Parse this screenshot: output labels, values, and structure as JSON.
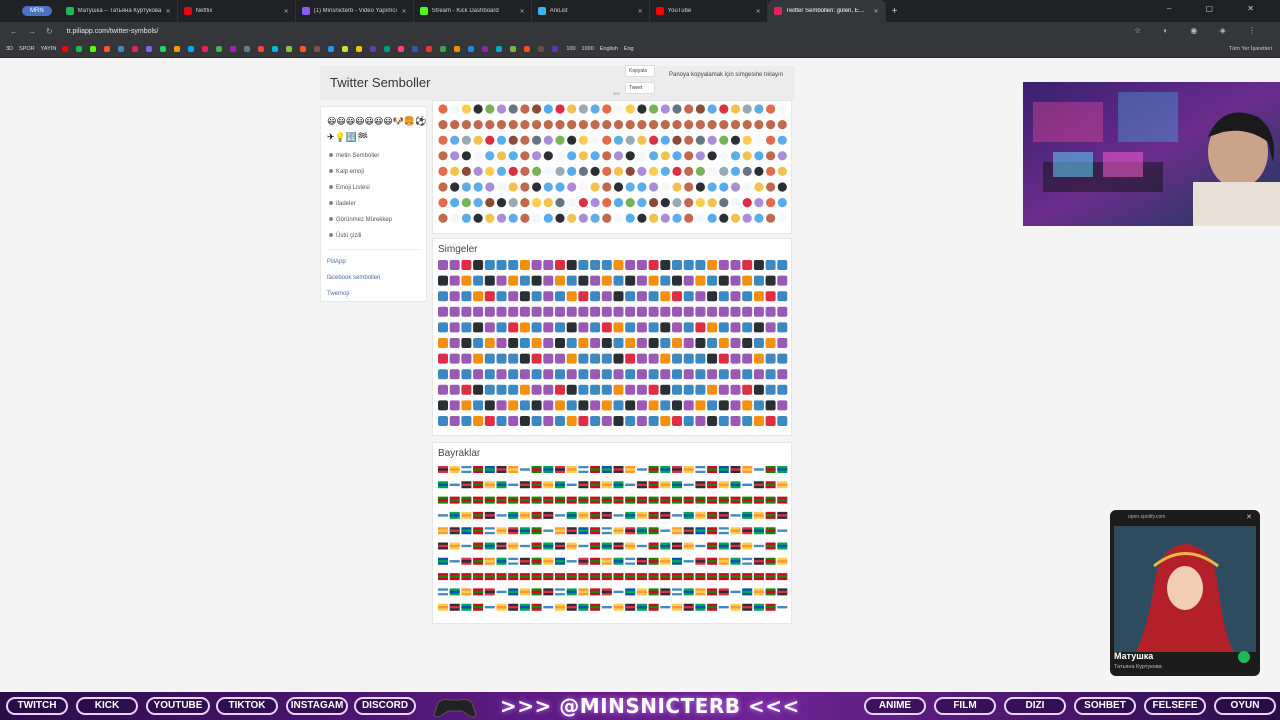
{
  "browser": {
    "tab_pill": "MRN",
    "tabs": [
      {
        "title": "Матушка – Татьяна Куртукова",
        "color": "#1db954",
        "active": false
      },
      {
        "title": "Netflix",
        "color": "#e50914",
        "active": false
      },
      {
        "title": "(1) Minsnicterb - Video Yapımcı",
        "color": "#8a5cf6",
        "active": false
      },
      {
        "title": "Stream - Kick Dashboard",
        "color": "#53fc18",
        "active": false
      },
      {
        "title": "AniList",
        "color": "#3db4f2",
        "active": false
      },
      {
        "title": "YouTube",
        "color": "#ff0000",
        "active": false
      },
      {
        "title": "Twitter Sembolleri: gülen, Emoji",
        "color": "#e0245e",
        "active": true
      }
    ],
    "url": "tr.piliapp.com/twitter-symbols/",
    "bookmarks_left": [
      "3D",
      "SPOR",
      "YAYIN"
    ],
    "bookmarks_right": [
      "100",
      "1000",
      "English",
      "Eng"
    ],
    "all_bookmarks": "Tüm Yer İşaretleri"
  },
  "site": {
    "title": "Twitter Semboller",
    "copy_button": "Kopyala",
    "tweet_button": "Tweet",
    "counter": "200",
    "copy_hint": "Panoya kopyalamak için simgesine tıklayın",
    "sidebar_emojis": "😃😃😃😃😃😃😃🐶🍔⚽✈💡🔣🏁",
    "sidebar_links": [
      "metin Semboller",
      "Kalp emoji",
      "Emoji Listesi",
      "ifadeler",
      "Görünmez Mürekkep",
      "Üstü çizili"
    ],
    "external_links": [
      "PiliApp",
      "facebook sembolleri",
      "Twemoji"
    ],
    "sections": [
      {
        "title": "",
        "rows": 8
      },
      {
        "title": "Simgeler",
        "rows": 11
      },
      {
        "title": "Bayraklar",
        "rows": 10
      }
    ]
  },
  "spotify": {
    "url": "open.spotify.com",
    "title": "Матушка",
    "artist": "Татьяна Куртукова"
  },
  "footer": {
    "left_buttons": [
      "TWITCH",
      "KICK",
      "YOUTUBE",
      "TIKTOK",
      "INSTAGAM",
      "DISCORD"
    ],
    "handle": ">>> @MINSNICTERB <<<",
    "right_buttons": [
      "ANIME",
      "FILM",
      "DIZI",
      "SOHBET",
      "FELSEFE",
      "OYUN"
    ]
  },
  "colors": {
    "symbol_purple": "#9b59b6",
    "symbol_blue": "#3b88c3",
    "symbol_red": "#dd2e44",
    "symbol_orange": "#f4900c",
    "footer_accent": "#c97dff"
  }
}
